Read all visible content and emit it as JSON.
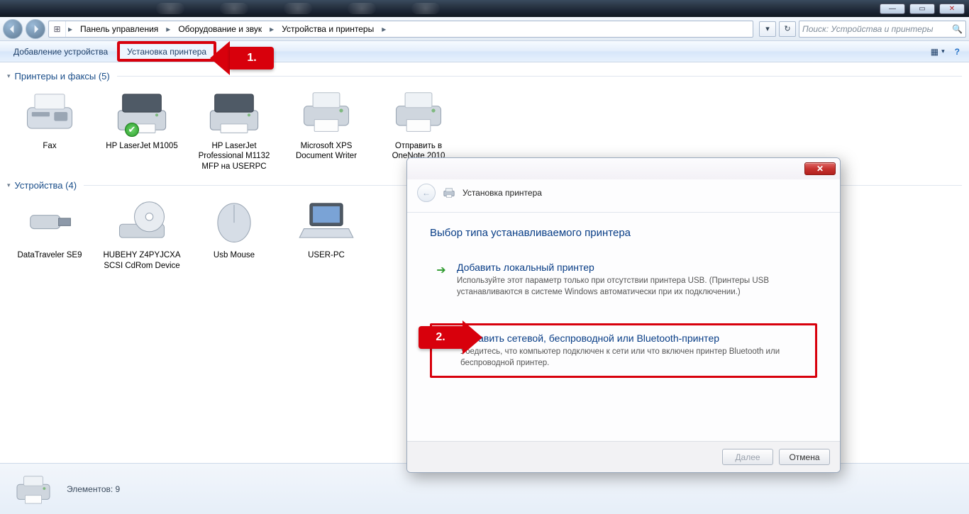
{
  "window_controls": {
    "min": "—",
    "max": "▭",
    "close": "✕"
  },
  "breadcrumb": {
    "items": [
      "Панель управления",
      "Оборудование и звук",
      "Устройства и принтеры"
    ]
  },
  "search": {
    "placeholder": "Поиск: Устройства и принтеры"
  },
  "toolbar": {
    "add_device": "Добавление устройства",
    "add_printer": "Установка принтера"
  },
  "callouts": {
    "one": "1.",
    "two": "2."
  },
  "groups": {
    "printers": {
      "title": "Принтеры и факсы (5)"
    },
    "devices": {
      "title": "Устройства (4)"
    }
  },
  "printers": [
    {
      "name": "Fax"
    },
    {
      "name": "HP LaserJet M1005",
      "default": true
    },
    {
      "name": "HP LaserJet Professional M1132 MFP на USERPC"
    },
    {
      "name": "Microsoft XPS Document Writer"
    },
    {
      "name": "Отправить в OneNote 2010"
    }
  ],
  "devices": [
    {
      "name": "DataTraveler SE9"
    },
    {
      "name": "HUBEHY Z4PYJCXA SCSI CdRom Device"
    },
    {
      "name": "Usb Mouse"
    },
    {
      "name": "USER-PC"
    }
  ],
  "status": {
    "text": "Элементов: 9"
  },
  "wizard": {
    "title": "Установка принтера",
    "heading": "Выбор типа устанавливаемого принтера",
    "opt1": {
      "title": "Добавить локальный принтер",
      "desc": "Используйте этот параметр только при отсутствии принтера USB. (Принтеры USB устанавливаются в системе Windows автоматически при их подключении.)"
    },
    "opt2": {
      "title": "Добавить сетевой, беспроводной или Bluetooth-принтер",
      "desc": "Убедитесь, что компьютер подключен к сети или что включен принтер Bluetooth или беспроводной принтер."
    },
    "next": "Далее",
    "cancel": "Отмена"
  }
}
